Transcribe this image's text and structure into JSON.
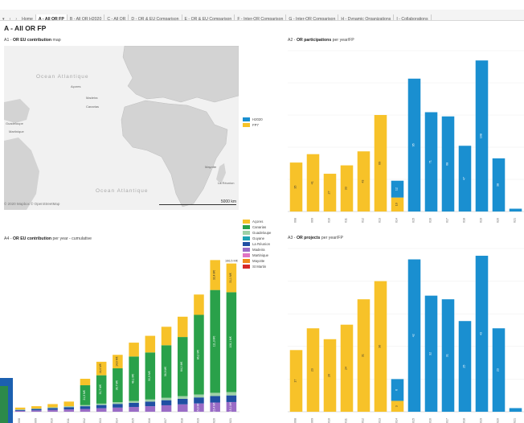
{
  "tabs": {
    "controls": [
      "▾",
      "‹",
      "›"
    ],
    "items": [
      {
        "label": "Home",
        "active": false
      },
      {
        "label": "A - All OR FP",
        "active": true
      },
      {
        "label": "B - All OR H2020",
        "active": false
      },
      {
        "label": "C - All OR",
        "active": false
      },
      {
        "label": "D - OR & EU Comparison",
        "active": false
      },
      {
        "label": "E - OR & EU Comparison",
        "active": false
      },
      {
        "label": "F - Inter-OR Comparison",
        "active": false
      },
      {
        "label": "G - Inter-OR Comparison",
        "active": false
      },
      {
        "label": "H - Dynamic Organizations",
        "active": false
      },
      {
        "label": "I - Collaborations",
        "active": false
      }
    ]
  },
  "page_title": "A - All OR FP",
  "panels": {
    "a1": {
      "prefix": "A1 - ",
      "bold": "OR EU contribution",
      "suffix": " map"
    },
    "a2": {
      "prefix": "A2 - ",
      "bold": "OR participations",
      "suffix": " per year/FP"
    },
    "a3": {
      "prefix": "A3 - ",
      "bold": "OR projects",
      "suffix": " per year/FP"
    },
    "a4": {
      "prefix": "A4 - ",
      "bold": "OR EU contribution",
      "suffix": " per year - cumulative"
    }
  },
  "map": {
    "labels": [
      "Ocean Atlantique",
      "Açores",
      "Madeira",
      "Canarias",
      "Guadeloupe",
      "Martinique",
      "Mayotte",
      "La Réunion",
      "Ocean Atlantique"
    ],
    "attribution": "© 2020 Mapbox © OpenStreetMap",
    "scale": "5000 km",
    "fp_legend": [
      {
        "name": "H2020",
        "color": "#1a8fd0"
      },
      {
        "name": "FP7",
        "color": "#f7c229"
      }
    ]
  },
  "region_legend": [
    {
      "name": "Açores",
      "color": "#f7c229"
    },
    {
      "name": "Canarias",
      "color": "#2aa14a"
    },
    {
      "name": "Guadeloupe",
      "color": "#9fd1a7"
    },
    {
      "name": "Guyane",
      "color": "#1fa3b3"
    },
    {
      "name": "La Réunion",
      "color": "#1f4fa3"
    },
    {
      "name": "Madeira",
      "color": "#9a6cc6"
    },
    {
      "name": "Martinique",
      "color": "#e074c4"
    },
    {
      "name": "Mayotte",
      "color": "#f08a1c"
    },
    {
      "name": "St Martin",
      "color": "#d62828"
    }
  ],
  "chart_data": [
    {
      "type": "bar",
      "title": "A2 - OR participations per year/FP",
      "categories": [
        "2008",
        "2009",
        "2010",
        "2011",
        "2012",
        "2013",
        "2014",
        "2015",
        "2016",
        "2017",
        "2018",
        "2019",
        "2020",
        "2021"
      ],
      "series": [
        {
          "name": "FP7",
          "color": "#f7c229",
          "values": [
            35,
            41,
            27,
            33,
            43,
            69,
            10,
            0,
            0,
            0,
            0,
            0,
            0,
            0
          ]
        },
        {
          "name": "H2020",
          "color": "#1a8fd0",
          "values": [
            0,
            0,
            0,
            0,
            0,
            0,
            12,
            95,
            71,
            68,
            47,
            108,
            38,
            2
          ]
        }
      ],
      "ylim": [
        0,
        115
      ]
    },
    {
      "type": "bar",
      "title": "A3 - OR projects per year/FP",
      "categories": [
        "2008",
        "2009",
        "2010",
        "2011",
        "2012",
        "2013",
        "2014",
        "2015",
        "2016",
        "2017",
        "2018",
        "2019",
        "2020",
        "2021"
      ],
      "series": [
        {
          "name": "FP7",
          "color": "#f7c229",
          "values": [
            17,
            23,
            20,
            24,
            31,
            36,
            3,
            0,
            0,
            0,
            0,
            0,
            0,
            0
          ]
        },
        {
          "name": "H2020",
          "color": "#1a8fd0",
          "values": [
            0,
            0,
            0,
            0,
            0,
            0,
            6,
            42,
            32,
            31,
            25,
            43,
            23,
            1
          ]
        }
      ],
      "ylim": [
        0,
        45
      ]
    },
    {
      "type": "bar",
      "title": "A4 - OR EU contribution per year - cumulative",
      "categories": [
        "2008",
        "2009",
        "2010",
        "2011",
        "2012",
        "2013",
        "2014",
        "2015",
        "2016",
        "2017",
        "2018",
        "2019",
        "2020",
        "2021"
      ],
      "series": [
        {
          "name": "Madeira",
          "color": "#9a6cc6",
          "values": [
            1.0,
            1.5,
            2.0,
            2.5,
            3.0,
            3.8,
            4.5,
            5.2,
            6.0,
            7.0,
            8.0,
            9.0,
            10.0,
            10.5
          ]
        },
        {
          "name": "La Réunion",
          "color": "#1f4fa3",
          "values": [
            1.0,
            1.5,
            2.0,
            2.5,
            3.0,
            3.5,
            4.0,
            4.5,
            5.0,
            5.5,
            6.0,
            6.5,
            7.0,
            7.2
          ]
        },
        {
          "name": "Guadeloupe",
          "color": "#9fd1a7",
          "values": [
            0.5,
            0.5,
            0.8,
            1.0,
            1.2,
            1.5,
            1.8,
            2.0,
            2.3,
            2.6,
            2.9,
            3.2,
            3.5,
            3.6
          ]
        },
        {
          "name": "Canarias",
          "color": "#2aa14a",
          "values": [
            0,
            0,
            0,
            0,
            21.5,
            30.7,
            36.7,
            48.1,
            50.9,
            56.9,
            64.0,
            86.2,
            111.3,
            108.1
          ]
        },
        {
          "name": "Açores",
          "color": "#f7c229",
          "values": [
            2.0,
            2.5,
            3.5,
            5.0,
            7.0,
            14.6,
            14.6,
            15.0,
            18.0,
            20.0,
            22.0,
            22.0,
            32.4,
            31.1
          ]
        }
      ],
      "labels": {
        "canarias": [
          "",
          "",
          "",
          "",
          "21,5 M€",
          "30,7 M€",
          "36,7 M€",
          "48,1 M€",
          "50,9 M€",
          "56,9 M€",
          "64,0 M€",
          "86,2 M€",
          "111,3 M€",
          "108,1 M€"
        ],
        "acores": [
          "",
          "",
          "",
          "",
          "",
          "14,6 M€",
          "14,6 M€",
          "",
          "",
          "",
          "",
          "",
          "32,4 M€",
          "31,1 M€"
        ],
        "madeira": [
          "",
          "",
          "",
          "",
          "",
          "",
          "",
          "",
          "",
          "",
          "",
          "15,6 M€",
          "15,4 M€",
          "15,1 M€"
        ]
      },
      "total_label": "166,5 M€",
      "ylim": [
        0,
        175
      ]
    }
  ]
}
